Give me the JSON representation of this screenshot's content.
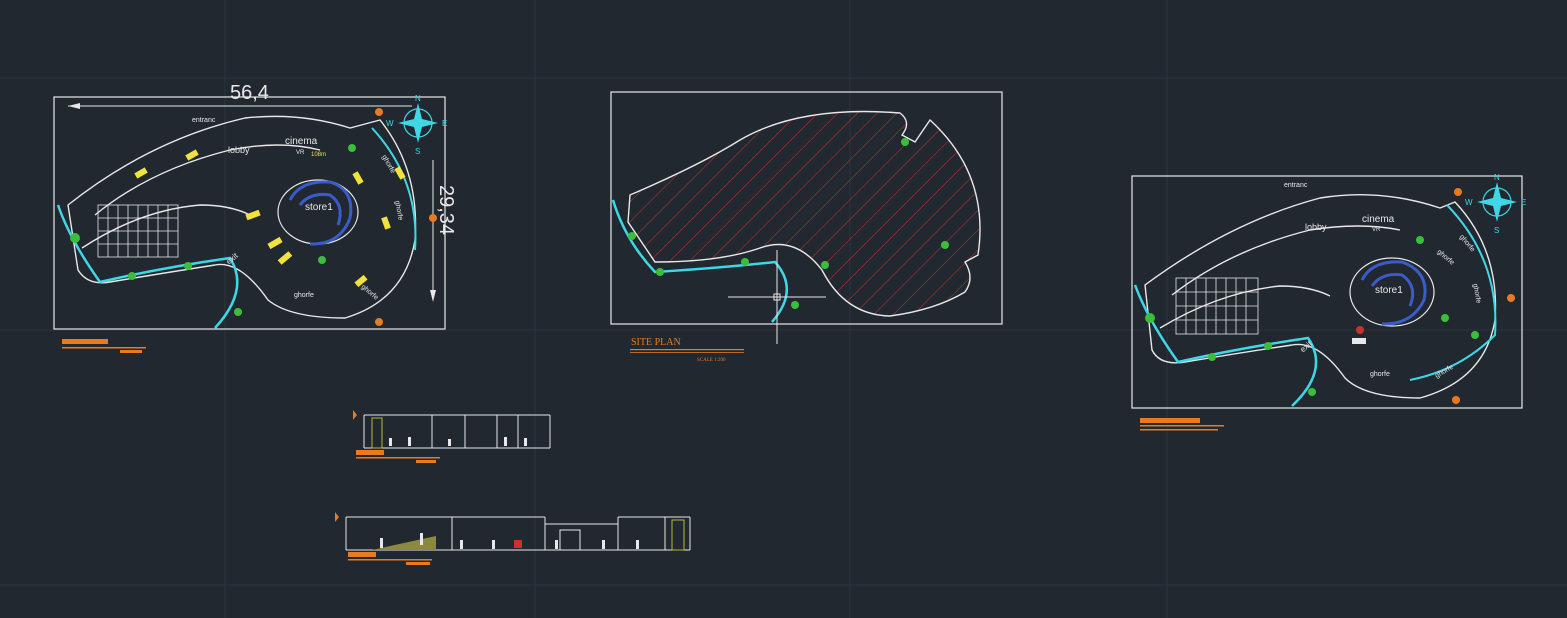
{
  "drawing": {
    "dim_width": "56,4",
    "dim_height": "29,34",
    "plan_labels": {
      "entrance": "entranc",
      "lobby": "lobby",
      "cinema": "cinema",
      "vr": "VR",
      "cinema_area": "108m",
      "store": "store1",
      "exit": "exit",
      "ghorfe": "ghorfe"
    },
    "compass": {
      "n": "N",
      "s": "S",
      "e": "E",
      "w": "W"
    },
    "site_plan": {
      "title": "SITE PLAN",
      "scale": "SCALE 1:200"
    }
  },
  "colors": {
    "background": "#212830",
    "linework": "#e8e8e8",
    "accent_cyan": "#3fd6e6",
    "accent_orange": "#e87a22",
    "hatch_red": "#c8322e",
    "grid": "#2c3540"
  }
}
